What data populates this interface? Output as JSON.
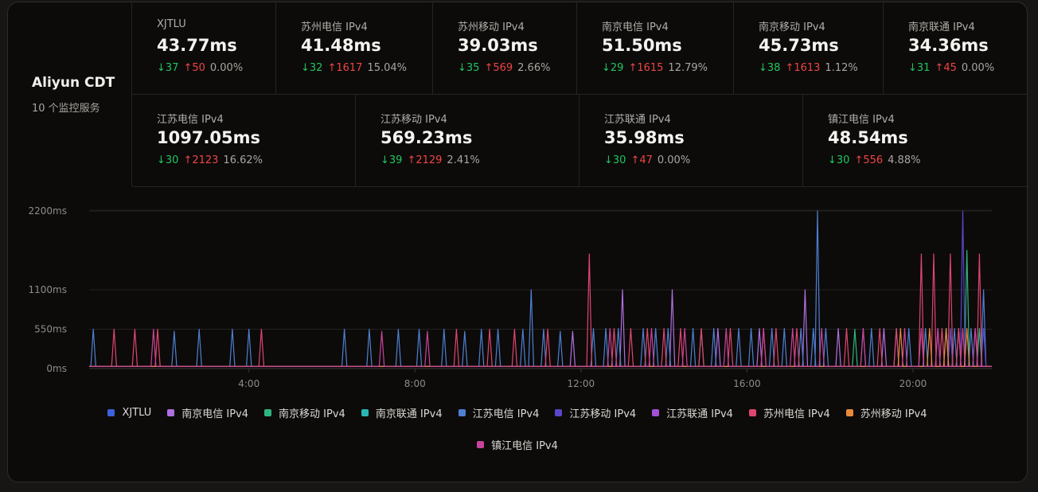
{
  "server": {
    "name": "Aliyun CDT",
    "count_text": "10 个监控服务"
  },
  "stats_row1": [
    {
      "label": "XJTLU",
      "value": "43.77ms",
      "down": "↓37",
      "up": "↑50",
      "pct": "0.00%"
    },
    {
      "label": "苏州电信 IPv4",
      "value": "41.48ms",
      "down": "↓32",
      "up": "↑1617",
      "pct": "15.04%"
    },
    {
      "label": "苏州移动 IPv4",
      "value": "39.03ms",
      "down": "↓35",
      "up": "↑569",
      "pct": "2.66%"
    },
    {
      "label": "南京电信 IPv4",
      "value": "51.50ms",
      "down": "↓29",
      "up": "↑1615",
      "pct": "12.79%"
    },
    {
      "label": "南京移动 IPv4",
      "value": "45.73ms",
      "down": "↓38",
      "up": "↑1613",
      "pct": "1.12%"
    },
    {
      "label": "南京联通 IPv4",
      "value": "34.36ms",
      "down": "↓31",
      "up": "↑45",
      "pct": "0.00%"
    }
  ],
  "stats_row2": [
    {
      "label": "江苏电信 IPv4",
      "value": "1097.05ms",
      "down": "↓30",
      "up": "↑2123",
      "pct": "16.62%"
    },
    {
      "label": "江苏移动 IPv4",
      "value": "569.23ms",
      "down": "↓39",
      "up": "↑2129",
      "pct": "2.41%"
    },
    {
      "label": "江苏联通 IPv4",
      "value": "35.98ms",
      "down": "↓30",
      "up": "↑47",
      "pct": "0.00%"
    },
    {
      "label": "镇江电信 IPv4",
      "value": "48.54ms",
      "down": "↓30",
      "up": "↑556",
      "pct": "4.88%"
    }
  ],
  "legend_row1": [
    {
      "name": "XJTLU",
      "color": "#3b62d9"
    },
    {
      "name": "南京电信 IPv4",
      "color": "#b06fe0"
    },
    {
      "name": "南京移动 IPv4",
      "color": "#2fb57e"
    },
    {
      "name": "南京联通 IPv4",
      "color": "#2ab7b3"
    },
    {
      "name": "江苏电信 IPv4",
      "color": "#4f7fd1"
    },
    {
      "name": "江苏移动 IPv4",
      "color": "#5a46c9"
    },
    {
      "name": "江苏联通 IPv4",
      "color": "#a44fd6"
    },
    {
      "name": "苏州电信 IPv4",
      "color": "#e0456f"
    },
    {
      "name": "苏州移动 IPv4",
      "color": "#e88a3a"
    }
  ],
  "legend_row2": [
    {
      "name": "镇江电信 IPv4",
      "color": "#c9439a"
    }
  ],
  "chart_data": {
    "type": "line",
    "y_ticks": [
      "2200ms",
      "1100ms",
      "550ms",
      "0ms"
    ],
    "x_ticks": [
      "4:00",
      "8:00",
      "12:00",
      "16:00",
      "20:00"
    ],
    "ylim": [
      0,
      2200
    ],
    "xlim_hours": [
      0.15,
      21.9
    ],
    "grid": true,
    "legend_position": "bottom",
    "baseline_ms": 30,
    "series": [
      {
        "name": "XJTLU",
        "spikes": []
      },
      {
        "name": "南京电信 IPv4",
        "spikes": [
          [
            11.8,
            520
          ],
          [
            13.0,
            1100
          ],
          [
            14.2,
            1100
          ],
          [
            15.3,
            560
          ],
          [
            16.3,
            560
          ],
          [
            17.4,
            1100
          ],
          [
            18.2,
            560
          ],
          [
            19.3,
            560
          ],
          [
            20.6,
            560
          ],
          [
            21.1,
            560
          ]
        ]
      },
      {
        "name": "南京移动 IPv4",
        "spikes": [
          [
            14.9,
            550
          ],
          [
            18.6,
            550
          ],
          [
            20.9,
            550
          ],
          [
            21.3,
            1650
          ],
          [
            21.6,
            560
          ]
        ]
      },
      {
        "name": "南京联通 IPv4",
        "spikes": []
      },
      {
        "name": "江苏电信 IPv4",
        "spikes": [
          [
            0.25,
            550
          ],
          [
            2.2,
            520
          ],
          [
            2.8,
            550
          ],
          [
            3.6,
            550
          ],
          [
            4.0,
            550
          ],
          [
            6.3,
            550
          ],
          [
            6.9,
            550
          ],
          [
            7.6,
            550
          ],
          [
            8.1,
            550
          ],
          [
            8.7,
            550
          ],
          [
            9.2,
            520
          ],
          [
            9.6,
            550
          ],
          [
            10.0,
            550
          ],
          [
            10.6,
            550
          ],
          [
            10.8,
            1100
          ],
          [
            11.1,
            550
          ],
          [
            11.5,
            520
          ],
          [
            12.3,
            560
          ],
          [
            12.6,
            560
          ],
          [
            12.9,
            560
          ],
          [
            13.5,
            560
          ],
          [
            13.8,
            560
          ],
          [
            14.1,
            560
          ],
          [
            14.7,
            560
          ],
          [
            15.2,
            560
          ],
          [
            15.8,
            560
          ],
          [
            16.1,
            560
          ],
          [
            16.6,
            560
          ],
          [
            16.9,
            560
          ],
          [
            17.3,
            560
          ],
          [
            17.6,
            560
          ],
          [
            17.7,
            2200
          ],
          [
            17.9,
            560
          ],
          [
            18.8,
            560
          ],
          [
            19.0,
            560
          ],
          [
            19.6,
            560
          ],
          [
            19.9,
            560
          ],
          [
            20.3,
            560
          ],
          [
            20.8,
            560
          ],
          [
            21.0,
            560
          ],
          [
            21.4,
            560
          ],
          [
            21.7,
            1100
          ]
        ]
      },
      {
        "name": "江苏移动 IPv4",
        "spikes": [
          [
            20.6,
            560
          ],
          [
            20.9,
            560
          ],
          [
            21.2,
            2200
          ],
          [
            21.5,
            560
          ],
          [
            21.7,
            560
          ]
        ]
      },
      {
        "name": "江苏联通 IPv4",
        "spikes": []
      },
      {
        "name": "苏州电信 IPv4",
        "spikes": [
          [
            0.75,
            550
          ],
          [
            1.25,
            550
          ],
          [
            1.8,
            550
          ],
          [
            4.3,
            550
          ],
          [
            9.0,
            550
          ],
          [
            9.8,
            550
          ],
          [
            10.4,
            550
          ],
          [
            11.2,
            550
          ],
          [
            12.2,
            1600
          ],
          [
            12.8,
            560
          ],
          [
            13.2,
            560
          ],
          [
            13.6,
            560
          ],
          [
            14.0,
            560
          ],
          [
            14.4,
            560
          ],
          [
            14.9,
            560
          ],
          [
            15.6,
            560
          ],
          [
            16.4,
            560
          ],
          [
            16.7,
            560
          ],
          [
            17.2,
            560
          ],
          [
            18.4,
            560
          ],
          [
            19.2,
            560
          ],
          [
            19.6,
            560
          ],
          [
            20.2,
            1600
          ],
          [
            20.5,
            1600
          ],
          [
            20.7,
            560
          ],
          [
            20.9,
            1600
          ],
          [
            21.1,
            560
          ],
          [
            21.6,
            1600
          ]
        ]
      },
      {
        "name": "苏州移动 IPv4",
        "spikes": [
          [
            19.7,
            560
          ],
          [
            20.4,
            560
          ],
          [
            20.8,
            560
          ],
          [
            21.3,
            560
          ]
        ]
      },
      {
        "name": "镇江电信 IPv4",
        "spikes": [
          [
            1.7,
            550
          ],
          [
            7.2,
            520
          ],
          [
            8.3,
            520
          ],
          [
            12.7,
            560
          ],
          [
            13.7,
            560
          ],
          [
            14.5,
            560
          ],
          [
            15.5,
            560
          ],
          [
            16.4,
            560
          ],
          [
            17.1,
            560
          ],
          [
            17.8,
            560
          ],
          [
            18.8,
            560
          ],
          [
            19.8,
            560
          ],
          [
            20.2,
            560
          ],
          [
            20.6,
            560
          ],
          [
            21.2,
            560
          ],
          [
            21.5,
            560
          ]
        ]
      }
    ]
  }
}
